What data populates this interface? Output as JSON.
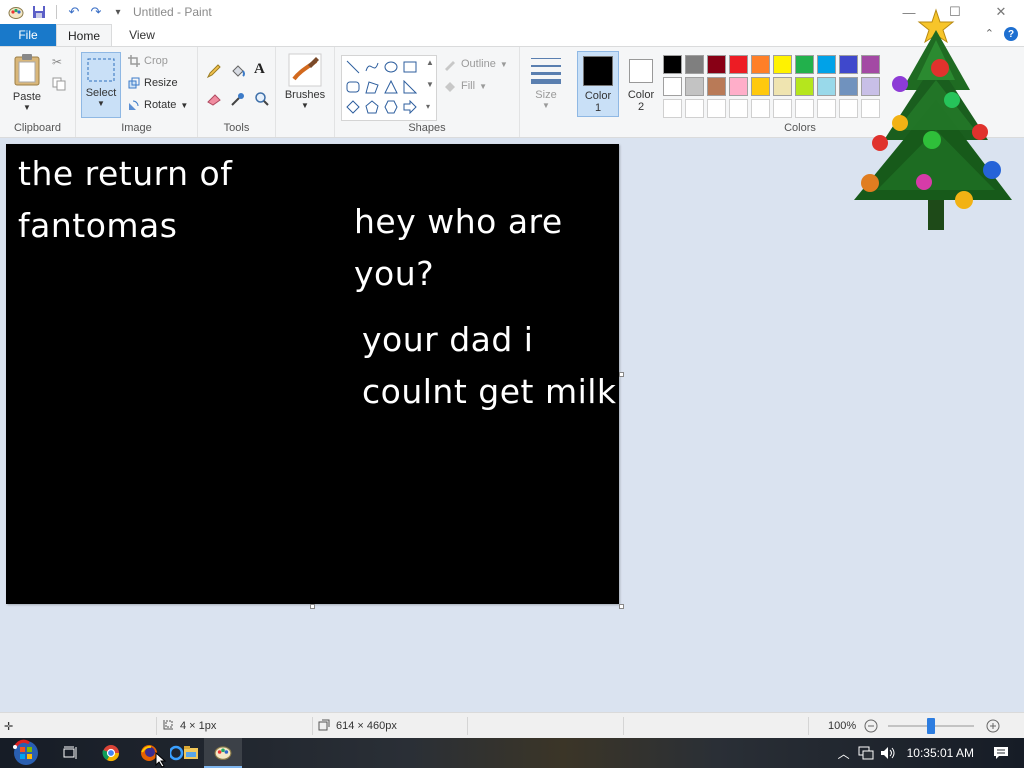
{
  "window": {
    "title": "Untitled - Paint",
    "controls": [
      "—",
      "☐",
      "✕"
    ]
  },
  "tabs": [
    {
      "label": "File"
    },
    {
      "label": "Home"
    },
    {
      "label": "View"
    }
  ],
  "ribbon": {
    "clipboard": {
      "paste_label": "Paste",
      "group_label": "Clipboard"
    },
    "image": {
      "select_label": "Select",
      "crop_label": "Crop",
      "resize_label": "Resize",
      "rotate_label": "Rotate",
      "group_label": "Image"
    },
    "tools": {
      "group_label": "Tools",
      "brushes_label": "Brushes"
    },
    "shapes": {
      "outline_label": "Outline",
      "fill_label": "Fill",
      "group_label": "Shapes"
    },
    "size": {
      "label": "Size"
    },
    "color1": {
      "label_line1": "Color",
      "label_line2": "1",
      "value": "#000000"
    },
    "color2": {
      "label_line1": "Color",
      "label_line2": "2",
      "value": "#ffffff"
    },
    "colors": {
      "group_label": "Colors",
      "palette_row1": [
        "#000000",
        "#7f7f7f",
        "#880015",
        "#ed1c24",
        "#ff7f27",
        "#fff200",
        "#22b14c",
        "#00a2e8",
        "#3f48cc",
        "#a349a4"
      ],
      "palette_row2": [
        "#ffffff",
        "#c3c3c3",
        "#b97a57",
        "#ffaec9",
        "#ffc90e",
        "#efe4b0",
        "#b5e61d",
        "#99d9ea",
        "#7092be",
        "#c8bfe7"
      ],
      "palette_row3": [
        "#ffffff",
        "#ffffff",
        "#ffffff",
        "#ffffff",
        "#ffffff",
        "#ffffff",
        "#ffffff",
        "#ffffff",
        "#ffffff",
        "#ffffff"
      ]
    }
  },
  "canvas": {
    "background": "#000000",
    "texts": [
      {
        "line1": "the return of",
        "line2": "fantomas"
      },
      {
        "line1": "hey who are",
        "line2": "you?"
      },
      {
        "line1": "your dad i",
        "line2": "coulnt get milk"
      }
    ]
  },
  "status": {
    "cursor_pos": "4 × 1px",
    "canvas_size": "614 × 460px",
    "zoom": "100%",
    "zoom_level_percent": 100
  },
  "taskbar": {
    "clock": "10:35:01 AM",
    "items": [
      "start-button",
      "task-view",
      "chrome",
      "firefox",
      "file-explorer",
      "paint"
    ]
  }
}
